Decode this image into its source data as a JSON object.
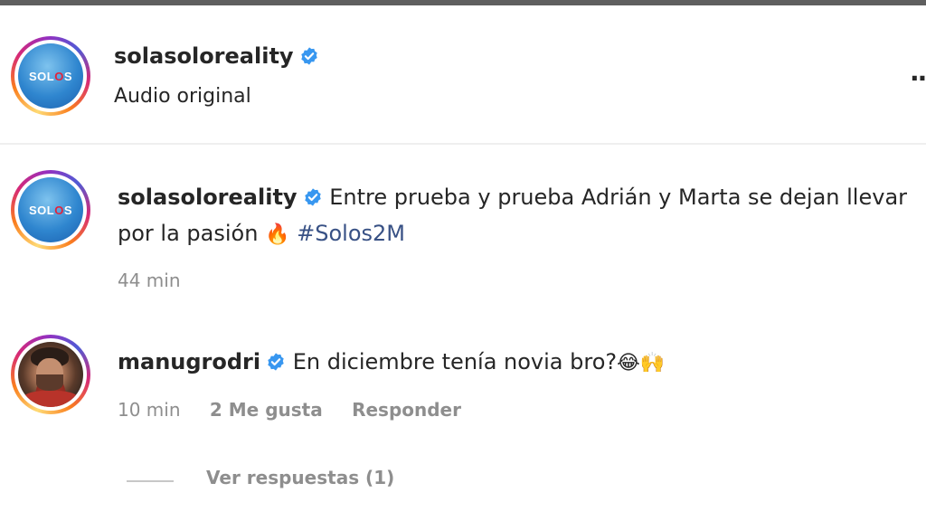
{
  "header": {
    "username": "solasoloreality",
    "subtitle": "Audio original",
    "avatar_logo": "SOLOS",
    "more_icon": "more-dots-icon"
  },
  "caption": {
    "username": "solasoloreality",
    "text_before_emoji": "Entre prueba y prueba Adrián y Marta se dejan llevar por la pasión",
    "emoji": "🔥",
    "hashtag": "#Solos2M",
    "time": "44 min"
  },
  "comment": {
    "username": "manugrodri",
    "text": "En diciembre tenía novia bro?",
    "emojis": "😂🙌",
    "time": "10 min",
    "likes": "2 Me gusta",
    "reply_label": "Responder"
  },
  "replies": {
    "label": "Ver respuestas (1)"
  },
  "colors": {
    "verified": "#3897f0",
    "hashtag": "#385185",
    "meta": "#8e8e8e",
    "divider": "#efefef"
  }
}
